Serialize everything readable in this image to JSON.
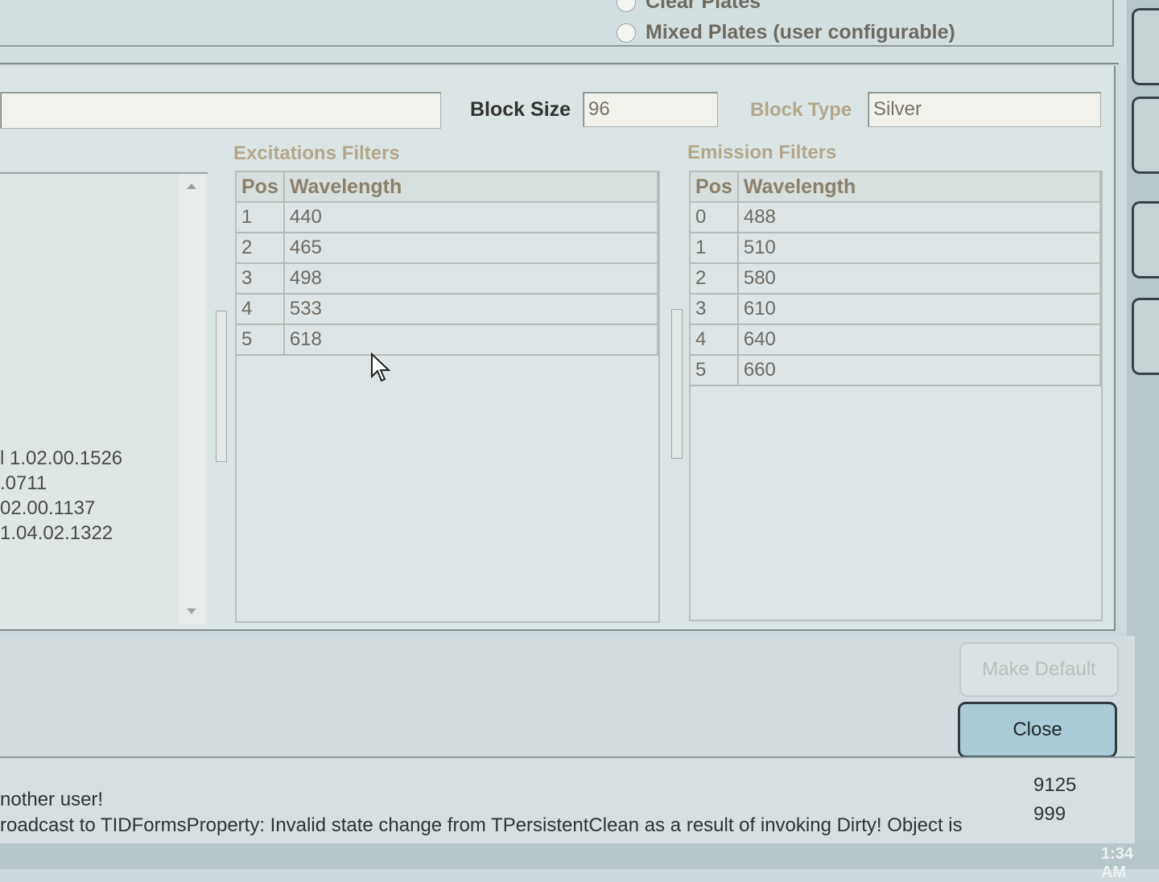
{
  "plate_options": {
    "clear_plates": "Clear Plates",
    "mixed_plates": "Mixed Plates (user configurable)"
  },
  "block": {
    "size_label": "Block Size",
    "size_value": "96",
    "type_label": "Block Type",
    "type_value": "Silver"
  },
  "excitation": {
    "title": "Excitations Filters",
    "headers": [
      "Pos",
      "Wavelength"
    ],
    "rows": [
      {
        "pos": "1",
        "wavelength": "440"
      },
      {
        "pos": "2",
        "wavelength": "465"
      },
      {
        "pos": "3",
        "wavelength": "498"
      },
      {
        "pos": "4",
        "wavelength": "533"
      },
      {
        "pos": "5",
        "wavelength": "618"
      }
    ]
  },
  "emission": {
    "title": "Emission Filters",
    "headers": [
      "Pos",
      "Wavelength"
    ],
    "rows": [
      {
        "pos": "0",
        "wavelength": "488"
      },
      {
        "pos": "1",
        "wavelength": "510"
      },
      {
        "pos": "2",
        "wavelength": "580"
      },
      {
        "pos": "3",
        "wavelength": "610"
      },
      {
        "pos": "4",
        "wavelength": "640"
      },
      {
        "pos": "5",
        "wavelength": "660"
      }
    ]
  },
  "versions": [
    "l 1.02.00.1526",
    ".0711",
    "02.00.1137",
    " 1.04.02.1322"
  ],
  "buttons": {
    "make_default": "Make Default",
    "close": "Close"
  },
  "status": {
    "line1": "nother user!",
    "line2": "roadcast to TIDFormsProperty: Invalid state change from TPersistentClean as a result of invoking Dirty! Object is",
    "num1": "9125",
    "num2": "999"
  },
  "clock": "1:34 AM"
}
